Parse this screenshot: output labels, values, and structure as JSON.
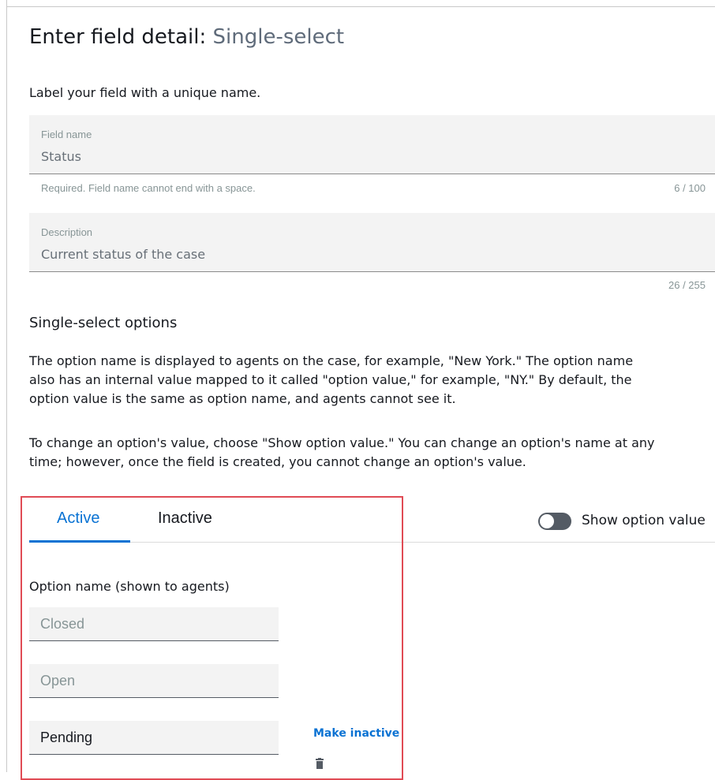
{
  "header": {
    "title_prefix": "Enter field detail:",
    "title_type": "Single-select"
  },
  "intro": "Label your field with a unique name.",
  "field_name": {
    "label": "Field name",
    "value": "Status",
    "hint": "Required. Field name cannot end with a space.",
    "counter": "6 / 100"
  },
  "description": {
    "label": "Description",
    "value": "Current status of the case",
    "counter": "26 / 255"
  },
  "options_section": {
    "title": "Single-select options",
    "para1_line1": "The option name is displayed to agents on the case, for example, \"New York.\" The option name",
    "para1_line2": "also has an internal value mapped to it called \"option value,\" for example, \"NY.\" By default, the",
    "para1_line3": "option value is the same as option name, and agents cannot see it.",
    "para2_line1": "To change an option's value, choose \"Show option value.\" You can change an option's name at any",
    "para2_line2": "time; however, once the field is created, you cannot change an option's value."
  },
  "tabs": [
    {
      "label": "Active",
      "selected": true
    },
    {
      "label": "Inactive",
      "selected": false
    }
  ],
  "toggle": {
    "label": "Show option value",
    "on": false
  },
  "options": {
    "header": "Option name (shown to agents)",
    "items": [
      "Closed",
      "Open",
      "Pending"
    ],
    "make_inactive_label": "Make inactive"
  },
  "colors": {
    "accent": "#0972d3",
    "highlight_border": "#e04b55",
    "toggle_off": "#545b64"
  },
  "icons": [
    "trash-icon"
  ]
}
